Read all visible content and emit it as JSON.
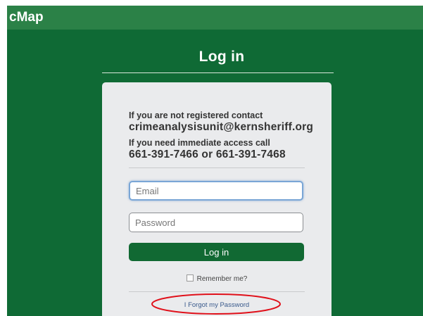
{
  "app": {
    "brand": "cMap"
  },
  "page": {
    "title": "Log in"
  },
  "notice": {
    "register_line": "If you are not registered contact",
    "register_email": "crimeanalysisunit@kernsheriff.org",
    "access_line": "If you need immediate access call",
    "access_phones": "661-391-7466 or 661-391-7468"
  },
  "form": {
    "email_placeholder": "Email",
    "password_placeholder": "Password",
    "login_label": "Log in",
    "remember_label": "Remember me?",
    "remember_checked": false,
    "forgot_label": "I Forgot my Password"
  },
  "colors": {
    "background": "#0f6a35",
    "topbar": "#2b8147",
    "card": "#eaebed",
    "button": "#116933",
    "annotation": "#e0101a"
  },
  "annotation": {
    "shape": "ellipse",
    "target": "forgot-password-link"
  }
}
